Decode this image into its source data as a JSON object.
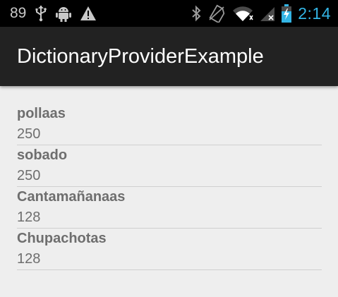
{
  "status_bar": {
    "notification_count": "89",
    "clock": "2:14",
    "icons": [
      "usb-icon",
      "android-debug-icon",
      "warning-icon",
      "bluetooth-icon",
      "no-sim-icon",
      "wifi-icon",
      "signal-icon",
      "battery-icon"
    ],
    "clock_color": "#33b5e5"
  },
  "action_bar": {
    "title": "DictionaryProviderExample"
  },
  "words": [
    {
      "word": "pollaas",
      "frequency": "250"
    },
    {
      "word": "sobado",
      "frequency": "250"
    },
    {
      "word": "Cantamañanaas",
      "frequency": "128"
    },
    {
      "word": "Chupachotas",
      "frequency": "128"
    }
  ]
}
